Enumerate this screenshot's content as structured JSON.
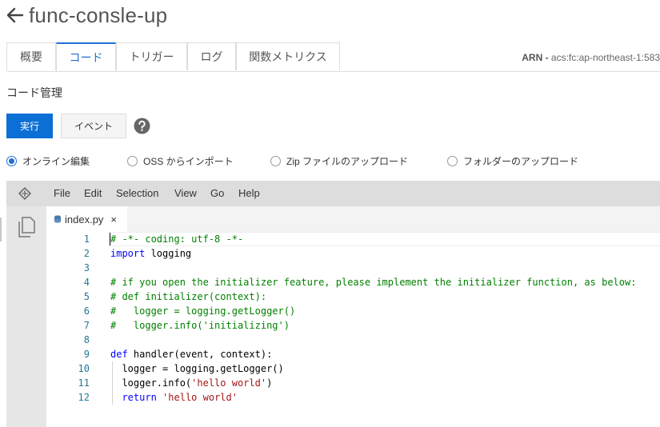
{
  "header": {
    "title": "func-consle-up"
  },
  "tabs": [
    {
      "label": "概要",
      "active": false
    },
    {
      "label": "コード",
      "active": true
    },
    {
      "label": "トリガー",
      "active": false
    },
    {
      "label": "ログ",
      "active": false
    },
    {
      "label": "関数メトリクス",
      "active": false
    }
  ],
  "arn": {
    "label": "ARN -",
    "value": "acs:fc:ap-northeast-1:583"
  },
  "section": {
    "title": "コード管理"
  },
  "actions": {
    "run_label": "実行",
    "event_label": "イベント",
    "help_icon": "question-circle-icon"
  },
  "source_options": [
    {
      "label": "オンライン編集",
      "checked": true
    },
    {
      "label": "OSS からインポート",
      "checked": false
    },
    {
      "label": "Zip ファイルのアップロード",
      "checked": false
    },
    {
      "label": "フォルダーのアップロード",
      "checked": false
    }
  ],
  "editor": {
    "menu": [
      "File",
      "Edit",
      "Selection",
      "View",
      "Go",
      "Help"
    ],
    "open_file": "index.py",
    "close_glyph": "×",
    "lines": [
      {
        "n": "1",
        "tokens": [
          {
            "t": "# -*- coding: utf-8 -*-",
            "c": "comment"
          }
        ]
      },
      {
        "n": "2",
        "tokens": [
          {
            "t": "import",
            "c": "kw"
          },
          {
            "t": " logging",
            "c": "plain"
          }
        ]
      },
      {
        "n": "3",
        "tokens": []
      },
      {
        "n": "4",
        "tokens": [
          {
            "t": "# if you open the initializer feature, please implement the initializer function, as below:",
            "c": "comment"
          }
        ]
      },
      {
        "n": "5",
        "tokens": [
          {
            "t": "# def initializer(context):",
            "c": "comment"
          }
        ]
      },
      {
        "n": "6",
        "tokens": [
          {
            "t": "#   logger = logging.getLogger()",
            "c": "comment"
          }
        ]
      },
      {
        "n": "7",
        "tokens": [
          {
            "t": "#   logger.info('initializing')",
            "c": "comment"
          }
        ]
      },
      {
        "n": "8",
        "tokens": []
      },
      {
        "n": "9",
        "tokens": [
          {
            "t": "def",
            "c": "kw"
          },
          {
            "t": " handler(event, context):",
            "c": "plain"
          }
        ]
      },
      {
        "n": "10",
        "tokens": [
          {
            "t": "  logger = logging.getLogger()",
            "c": "plain"
          }
        ]
      },
      {
        "n": "11",
        "tokens": [
          {
            "t": "  logger.info(",
            "c": "plain"
          },
          {
            "t": "'hello world'",
            "c": "str"
          },
          {
            "t": ")",
            "c": "plain"
          }
        ]
      },
      {
        "n": "12",
        "tokens": [
          {
            "t": "  ",
            "c": "plain"
          },
          {
            "t": "return",
            "c": "kw"
          },
          {
            "t": " ",
            "c": "plain"
          },
          {
            "t": "'hello world'",
            "c": "str"
          }
        ]
      }
    ]
  }
}
